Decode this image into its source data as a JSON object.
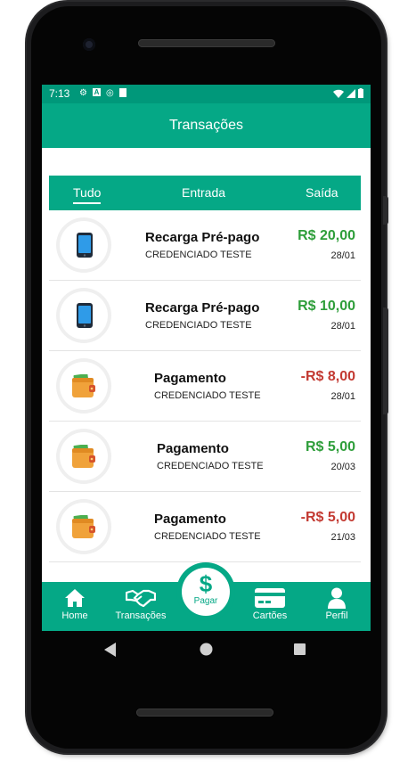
{
  "status": {
    "time": "7:13"
  },
  "appbar": {
    "title": "Transações"
  },
  "tabs": [
    {
      "label": "Tudo",
      "active": true
    },
    {
      "label": "Entrada",
      "active": false
    },
    {
      "label": "Saída",
      "active": false
    }
  ],
  "transactions": [
    {
      "icon": "phone-icon",
      "title": "Recarga Pré-pago",
      "subtitle": "CREDENCIADO TESTE",
      "amount": "R$ 20,00",
      "date": "28/01",
      "color": "#2e9e3a"
    },
    {
      "icon": "phone-icon",
      "title": "Recarga Pré-pago",
      "subtitle": "CREDENCIADO TESTE",
      "amount": "R$ 10,00",
      "date": "28/01",
      "color": "#2e9e3a"
    },
    {
      "icon": "wallet-icon",
      "title": "Pagamento",
      "subtitle": "CREDENCIADO TESTE",
      "amount": "-R$ 8,00",
      "date": "28/01",
      "color": "#c33a32"
    },
    {
      "icon": "wallet-icon",
      "title": "Pagamento",
      "subtitle": "CREDENCIADO TESTE",
      "amount": "R$ 5,00",
      "date": "20/03",
      "color": "#2e9e3a"
    },
    {
      "icon": "wallet-icon",
      "title": "Pagamento",
      "subtitle": "CREDENCIADO TESTE",
      "amount": "-R$ 5,00",
      "date": "21/03",
      "color": "#c33a32"
    }
  ],
  "bottom_nav": {
    "home": "Home",
    "transactions": "Transações",
    "pay_symbol": "$",
    "pay": "Pagar",
    "cards": "Cartões",
    "profile": "Perfil"
  },
  "colors": {
    "primary": "#05a886",
    "status_bar": "#00987a",
    "positive": "#2e9e3a",
    "negative": "#c33a32"
  }
}
